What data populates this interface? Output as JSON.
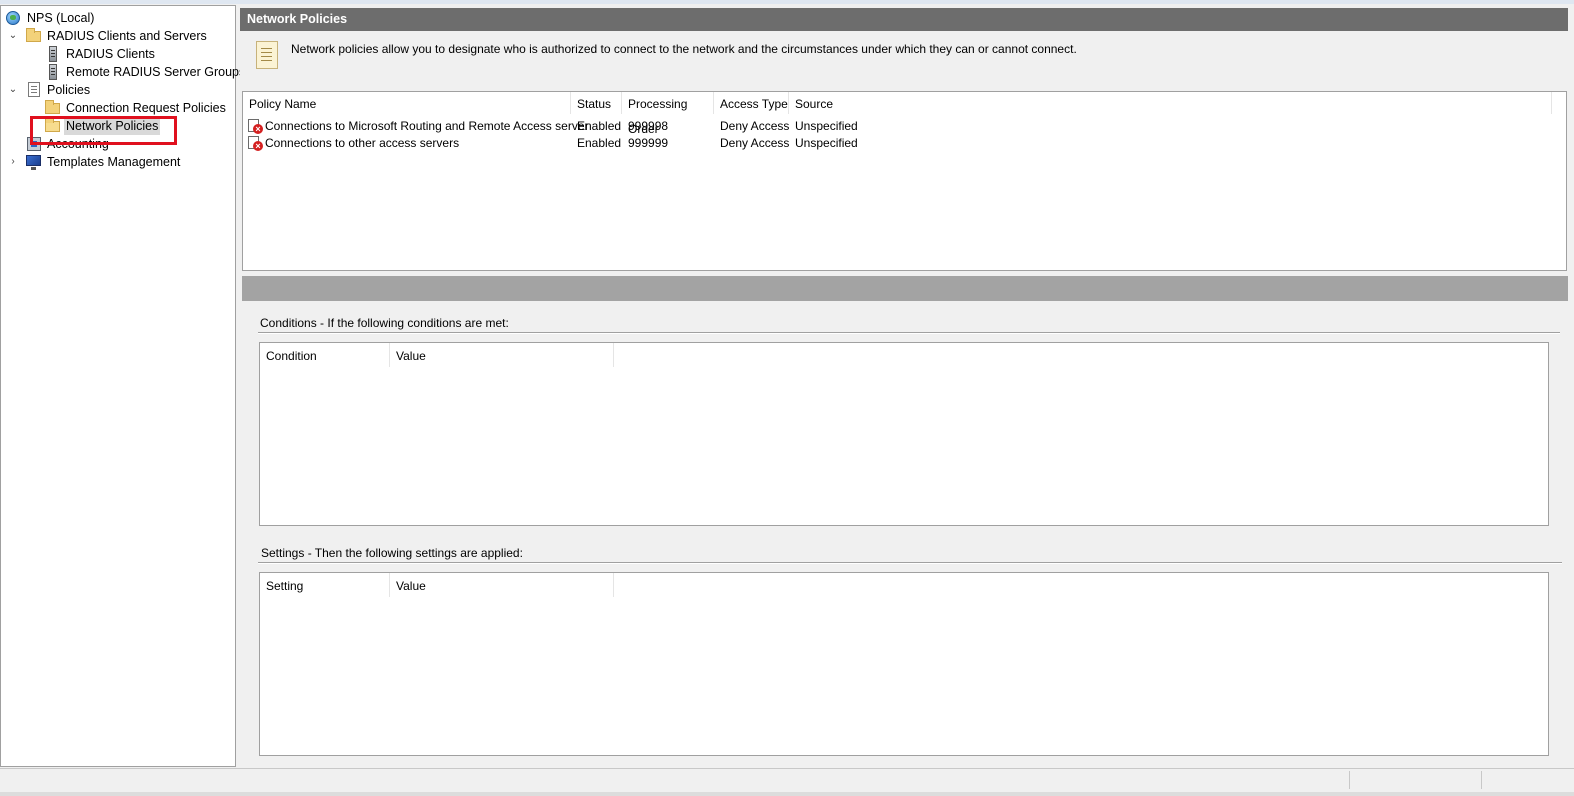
{
  "tree": {
    "items": [
      {
        "label": "NPS (Local)",
        "icon": "globe-icon"
      },
      {
        "label": "RADIUS Clients and Servers",
        "icon": "folder-icon",
        "expanded": true
      },
      {
        "label": "RADIUS Clients",
        "icon": "server-icon"
      },
      {
        "label": "Remote RADIUS Server Groups",
        "icon": "server-icon"
      },
      {
        "label": "Policies",
        "icon": "document-icon",
        "expanded": true
      },
      {
        "label": "Connection Request Policies",
        "icon": "folder-icon"
      },
      {
        "label": "Network Policies",
        "icon": "folder-open-icon",
        "selected": true
      },
      {
        "label": "Accounting",
        "icon": "accounting-icon"
      },
      {
        "label": "Templates Management",
        "icon": "monitor-icon",
        "expanded": false
      }
    ],
    "highlight_color": "#e0101e"
  },
  "header": {
    "title": "Network Policies"
  },
  "info": {
    "text": "Network policies allow you to designate who is authorized to connect to the network and the circumstances under which they can or cannot connect.",
    "icon": "document-note-icon"
  },
  "policy_table": {
    "columns": [
      "Policy Name",
      "Status",
      "Processing Order",
      "Access Type",
      "Source"
    ],
    "rows": [
      {
        "name": "Connections to Microsoft Routing and Remote Access server",
        "status": "Enabled",
        "order": "999998",
        "access": "Deny Access",
        "source": "Unspecified",
        "icon": "deny-policy-icon"
      },
      {
        "name": "Connections to other access servers",
        "status": "Enabled",
        "order": "999999",
        "access": "Deny Access",
        "source": "Unspecified",
        "icon": "deny-policy-icon"
      }
    ]
  },
  "conditions": {
    "label": "Conditions - If the following conditions are met:",
    "columns": [
      "Condition",
      "Value"
    ]
  },
  "settings": {
    "label": "Settings - Then the following settings are applied:",
    "columns": [
      "Setting",
      "Value"
    ]
  },
  "colors": {
    "header_bg": "#6d6d6d",
    "divider_bg": "#a3a3a3",
    "deny_icon": "#d42020"
  }
}
